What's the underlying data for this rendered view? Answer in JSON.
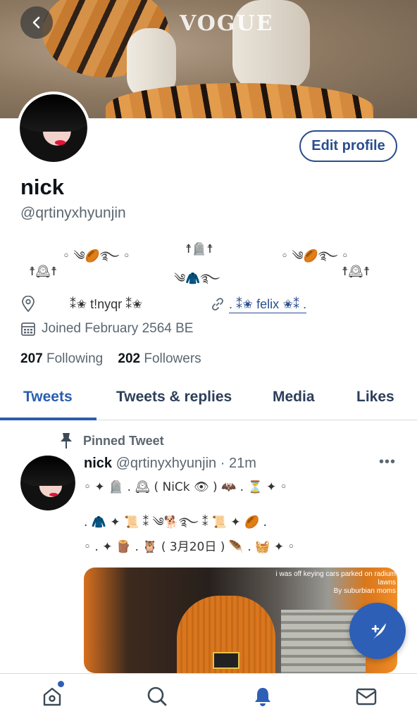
{
  "banner": {
    "magazine_text": "VOGUE"
  },
  "profile": {
    "name": "nick",
    "handle": "@qrtinyxhyunjin",
    "edit_label": "Edit profile",
    "bio": {
      "line1_left": "◦ ༄🏉࿐ ◦",
      "line1_mid": "☨🪦☨",
      "line1_right": "◦ ༄🏉࿐ ◦",
      "line2_left": "☨🕰☨",
      "line2_mid": "༄🧥࿐",
      "line2_right": "☨🕰☨"
    },
    "location": "⁑✬  t!nyqr  ⁑✬",
    "link": ".  ⁑✬  felix  ✬⁑  .",
    "joined": "Joined February 2564 BE",
    "following_count": "207",
    "following_label": "Following",
    "followers_count": "202",
    "followers_label": "Followers"
  },
  "tabs": [
    {
      "label": "Tweets"
    },
    {
      "label": "Tweets & replies"
    },
    {
      "label": "Media"
    },
    {
      "label": "Likes"
    }
  ],
  "tweet": {
    "pinned_label": "Pinned Tweet",
    "name": "nick",
    "handle_time": "@qrtinyxhyunjin · 21m",
    "more": "•••",
    "lines": [
      "◦ ✦ 🪦 . 🕰 ( NiCk 👁 ) 🦇 . ⏳ ✦ ◦",
      ". 🧥 ✦ 📜 ⁑ ༄🐕࿐ ⁑ 📜 ✦ 🏉 .",
      "◦ . ✦ 🪵 . 🦉 ( 3月20日 ) 🪶 . 🧺 ✦ ◦"
    ],
    "media_caption": "i was off keying cars parked on radium lawns\nBy suburbian moms"
  },
  "colors": {
    "accent": "#2a5db0",
    "link": "#2a4d8f",
    "fab": "#2d5fb6"
  }
}
